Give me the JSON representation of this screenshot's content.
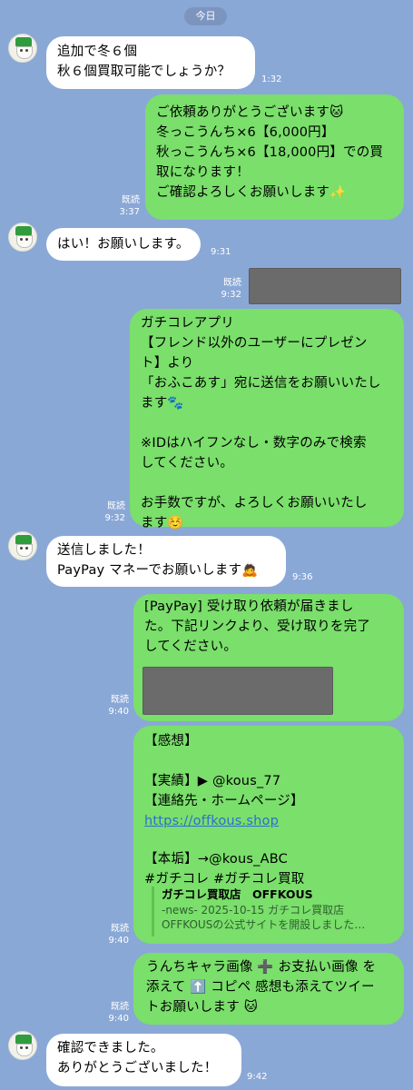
{
  "date_label": "今日",
  "messages": [
    {
      "id": "m1",
      "text": "追加で冬６個\n秋６個買取可能でしょうか？",
      "time": "1:32"
    },
    {
      "id": "m2",
      "text": "ご依頼ありがとうございます🐱\n冬っこうんち×6【6,000円】\n秋っこうんち×6【18,000円】での買\n取になります！\nご確認よろしくお願いします✨",
      "read": "既読",
      "time": "3:37"
    },
    {
      "id": "m3",
      "text": "はい！お願いします。",
      "time": "9:31"
    },
    {
      "id": "m4",
      "read": "既読",
      "time": "9:32"
    },
    {
      "id": "m5",
      "text": "ガチコレアプリ\n【フレンド以外のユーザーにプレゼン\nト】より\n「おふこあす」宛に送信をお願いいたし\nます🐾\n\n※IDはハイフンなし・数字のみで検索\nしてください。\n\nお手数ですが、よろしくお願いいたし\nます☺️",
      "read": "既読",
      "time": "9:32"
    },
    {
      "id": "m6",
      "text": "送信しました！\nPayPay マネーでお願いします🙇",
      "time": "9:36"
    },
    {
      "id": "m7",
      "text": "[PayPay] 受け取り依頼が届きまし\nた。下記リンクより、受け取りを完了\nしてください。",
      "read": "既読",
      "time": "9:40"
    },
    {
      "id": "m8",
      "lines": {
        "l1": "【感想】",
        "l2": "【実績】▶ @kous_77",
        "l3": "【連絡先・ホームページ】",
        "link": "https://offkous.shop",
        "l4": "【本垢】→@kous_ABC",
        "l5": "#ガチコレ #ガチコレ買取"
      },
      "preview": {
        "title": "ガチコレ買取店　OFFKOUS",
        "body": "-news- 2025-10-15 ガチコレ買取店\nOFFKOUSの公式サイトを開設しました…"
      },
      "read": "既読",
      "time": "9:40"
    },
    {
      "id": "m9",
      "text": "うんちキャラ画像 ➕ お支払い画像 を\n添えて ⬆️ コピペ 感想も添えてツイー\nトお願いします 🐱",
      "read": "既読",
      "time": "9:40"
    },
    {
      "id": "m10",
      "text": "確認できました。\nありがとうございました！",
      "time": "9:42"
    }
  ],
  "colors": {
    "background": "#8aa8d6",
    "outgoing": "#7adf6b",
    "incoming": "#ffffff",
    "link": "#2b6fd1"
  }
}
